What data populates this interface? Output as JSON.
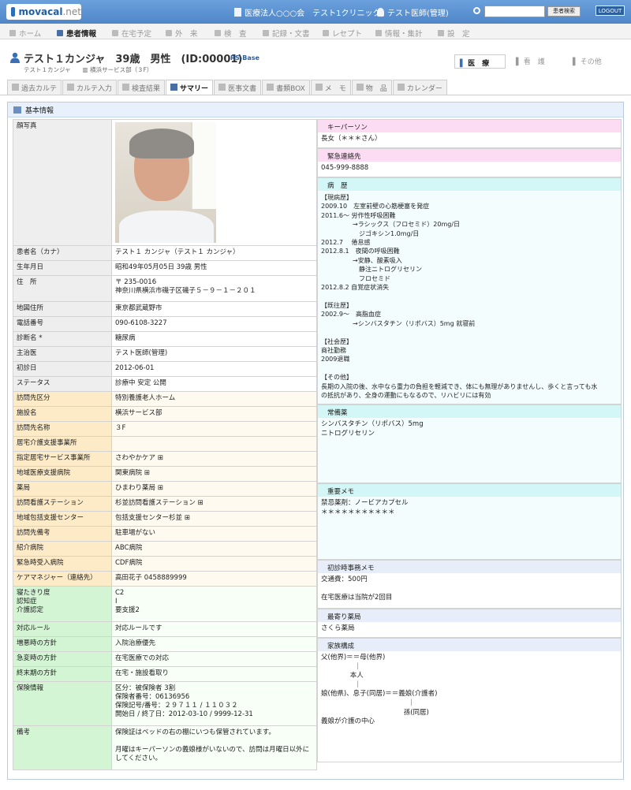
{
  "header": {
    "logo_main": "movacal",
    "logo_suffix": ".net",
    "org": "医療法人○○○会　テスト1クリニック",
    "user": "テスト医師(管理)",
    "search_button": "患者検索",
    "search_placeholder": "",
    "logout": "LOGOUT"
  },
  "nav": [
    "ホーム",
    "患者情報",
    "在宅予定",
    "外　来",
    "検　査",
    "記録・文書",
    "レセプト",
    "情報・集計",
    "設　定"
  ],
  "patient": {
    "name": "テスト１カンジャ　39歳　男性　(ID:00001)",
    "link": "RS-Base",
    "kana": "テスト１カンジャ",
    "facility": "横浜サービス部（３F）"
  },
  "modes": [
    "医　療",
    "看　護",
    "その他"
  ],
  "tabs": [
    "過去カルテ",
    "カルテ入力",
    "検査結果",
    "サマリー",
    "医事文書",
    "書類BOX",
    "メ　モ",
    "物　品",
    "カレンダー"
  ],
  "section_title": "基本情報",
  "left_rows": [
    {
      "label": "顔写真",
      "value": "",
      "g": 0,
      "photo": true
    },
    {
      "label": "患者名（カナ）",
      "value": "テスト１ カンジャ（テスト１ カンジャ）",
      "g": 0
    },
    {
      "label": "生年月日",
      "value": "昭和49年05月05日 39歳 男性",
      "g": 0
    },
    {
      "label": "住　所",
      "value": "〒 235-0016\n神奈川県横浜市磯子区磯子５－９－１－２０１",
      "g": 0
    },
    {
      "label": "地図住所",
      "value": "東京都武蔵野市",
      "g": 0
    },
    {
      "label": "電話番号",
      "value": "090-6108-3227",
      "g": 0
    },
    {
      "label": "診断名 *",
      "value": "糖尿病",
      "g": 0
    },
    {
      "label": "主治医",
      "value": "テスト医師(管理)",
      "g": 0
    },
    {
      "label": "初診日",
      "value": "2012-06-01",
      "g": 0
    },
    {
      "label": "ステータス",
      "value": "診療中 安定 公開",
      "g": 0
    },
    {
      "label": "訪問先区分",
      "value": "特別養護老人ホーム",
      "g": 1
    },
    {
      "label": "施設名",
      "value": "横浜サービス部",
      "g": 1
    },
    {
      "label": "訪問先名称",
      "value": "３F",
      "g": 1
    },
    {
      "label": "居宅介護支援事業所",
      "value": "",
      "g": 1
    },
    {
      "label": "指定居宅サービス事業所",
      "value": "さわやかケア ⊞",
      "g": 1
    },
    {
      "label": "地域医療支援病院",
      "value": "関東病院 ⊞",
      "g": 1
    },
    {
      "label": "薬局",
      "value": "ひまわり薬局 ⊞",
      "g": 1
    },
    {
      "label": "訪問看護ステーション",
      "value": "杉並訪問看護ステーション ⊞",
      "g": 1
    },
    {
      "label": "地域包括支援センター",
      "value": "包括支援センター杉並 ⊞",
      "g": 1
    },
    {
      "label": "訪問先備考",
      "value": "駐車場がない",
      "g": 1
    },
    {
      "label": "紹介病院",
      "value": "ABC病院",
      "g": 1
    },
    {
      "label": "緊急時受入病院",
      "value": "CDF病院",
      "g": 1
    },
    {
      "label": "ケアマネジャー（連絡先）",
      "value": "高田花子 0458889999",
      "g": 1
    },
    {
      "label": "寝たきり度\n認知症\n介護認定",
      "value": "C2\nⅠ\n要支援2",
      "g": 2
    },
    {
      "label": "対応ルール",
      "value": "対応ルールです",
      "g": 2
    },
    {
      "label": "増悪時の方針",
      "value": "入院治療優先",
      "g": 2
    },
    {
      "label": "急変時の方針",
      "value": "在宅医療での対応",
      "g": 2
    },
    {
      "label": "終末期の方針",
      "value": "在宅・施設看取り",
      "g": 2
    },
    {
      "label": "保険情報",
      "value": "区分：被保険者 3割\n保険者番号：06136956\n保険記号/番号：２９７１１ / １１０３２\n開始日 / 終了日：2012-03-10 / 9999-12-31",
      "g": 2
    },
    {
      "label": "備考",
      "value": "保険証はベッドの右の棚にいつも保管されています。\n\n月曜はキーパーソンの義娘様がいないので、訪問は月曜日以外に\nしてください。",
      "g": 2
    }
  ],
  "right_sections": [
    {
      "title": "キーパーソン",
      "body": "長女（＊＊＊さん）",
      "c": "pink",
      "h": 19
    },
    {
      "title": "緊急連絡先",
      "body": "045-999-8888",
      "c": "pink",
      "h": 19
    },
    {
      "title": "病　歴",
      "body": "【現病歴】\n2009.10　左室前壁の心筋梗塞を発症\n2011.6～ 労作性呼吸困難\n　　　　　→ラシックス（フロセミド）20mg/日\n　　　　　　ジゴキシン1.0mg/日\n2012.7　 倦怠感\n2012.8.1　夜間の呼吸困難\n　　　　　→安静、酸素吸入\n　　　　　　静注ニトログリセリン\n　　　　　　フロセミド\n2012.8.2 自覚症状消失\n\n【既往歴】\n2002.9～　高脂血症\n　　　　　→シンバスタチン（リポバス）5mg 就寝前\n\n【社会歴】\n商社勤務\n2009退職\n\n【その他】\n長期の入院の後、水中なら重力の負担を軽減でき、体にも無理がありませんし、歩くと言っても水\nの抵抗があり、全身の運動にもなるので、リハビリには有効",
      "c": "cyan",
      "h": 270
    },
    {
      "title": "常備薬",
      "body": "シンバスタチン（リポバス）5mg\nニトログリセリン",
      "c": "cyan",
      "h": 82
    },
    {
      "title": "重要メモ",
      "body": "禁忌薬剤：ノービアカプセル\n＊＊＊＊＊＊＊＊＊＊＊",
      "c": "cyan",
      "h": 79
    },
    {
      "title": "初診時事務メモ",
      "body": "交通費：500円\n\n在宅医療は当院が2回目",
      "c": "blue",
      "h": 44
    },
    {
      "title": "最寄り薬局",
      "body": "さくら薬局",
      "c": "blue",
      "h": 19
    },
    {
      "title": "家族構成",
      "body": "父(他界)＝＝母(他界)\n　　　　　｜\n　　　　 本人\n　　　　　｜\n娘(他県)、息子(同居)＝＝義娘(介護者)\n　　　　　　　　　　　　　｜\n　　　　　　　　　　　　 孫(同居)\n義娘が介護の中心",
      "c": "blue",
      "h": 140
    }
  ]
}
